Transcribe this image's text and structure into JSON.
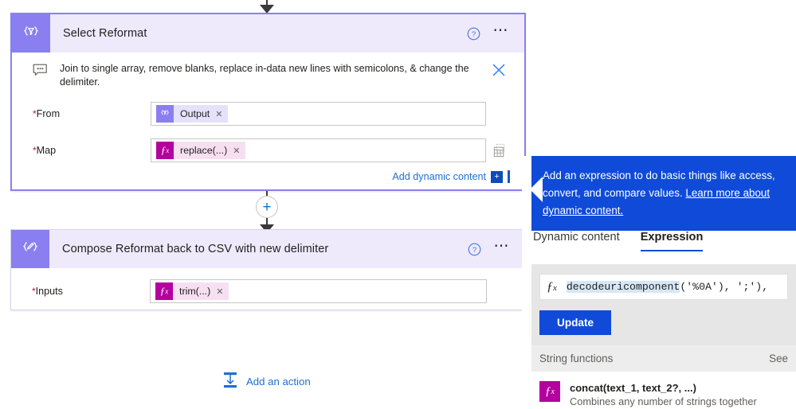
{
  "canvas": {
    "select_card": {
      "icon": "select-braces-funnel-icon",
      "title": "Select Reformat",
      "help_icon": "help-circle-icon",
      "more_icon": "more-ellipsis-icon",
      "comment": {
        "icon": "comment-bubble-icon",
        "text": "Join to single array, remove blanks, replace in-data new lines with semicolons, & change the delimiter.",
        "close_icon": "close-x-icon"
      },
      "fields": [
        {
          "label": "From",
          "required_marker": "*",
          "token": {
            "icon": "select-braces-funnel-icon",
            "label": "Output",
            "remove_icon": "remove-token-x-icon"
          },
          "trailing_icon": ""
        },
        {
          "label": "Map",
          "required_marker": "*",
          "token": {
            "icon": "fx-icon",
            "label": "replace(...)",
            "remove_icon": "remove-token-x-icon"
          },
          "trailing_icon": "table-copy-icon"
        }
      ],
      "dynamic_content": {
        "label": "Add dynamic content",
        "badge": "+"
      }
    },
    "compose_card": {
      "icon": "compose-braces-pencil-icon",
      "title": "Compose Reformat back to CSV with new delimiter",
      "help_icon": "help-circle-icon",
      "more_icon": "more-ellipsis-icon",
      "fields": [
        {
          "label": "Inputs",
          "required_marker": "*",
          "token": {
            "icon": "fx-icon",
            "label": "trim(...)",
            "remove_icon": "remove-token-x-icon"
          }
        }
      ]
    },
    "insert_step_button": {
      "icon": "plus-circle-icon",
      "label": "+"
    },
    "add_action": {
      "icon": "add-action-icon",
      "label": "Add an action"
    }
  },
  "panel": {
    "callout": {
      "text_before_link": "Add an expression to do basic things like access, convert, and compare values. ",
      "link_text": "Learn more about dynamic content."
    },
    "tabs": [
      {
        "label": "Dynamic content",
        "active": false
      },
      {
        "label": "Expression",
        "active": true
      }
    ],
    "expression": {
      "fx_icon": "fx-icon",
      "highlighted_text": "decodeuricomponent",
      "trailing_text": "('%0A'), ';'),",
      "update_label": "Update"
    },
    "function_section": {
      "title": "String functions",
      "see_more": "See"
    },
    "functions": [
      {
        "icon": "fx-icon",
        "signature": "concat(text_1, text_2?, ...)",
        "description": "Combines any number of strings together"
      }
    ]
  },
  "colors": {
    "accent_purple": "#8a7ff0",
    "card_header_bg": "#eeeafc",
    "callout_blue": "#0f4bd8",
    "fx_magenta": "#b4009e",
    "link_blue": "#1f6fd0",
    "required_red": "#a4262c"
  }
}
